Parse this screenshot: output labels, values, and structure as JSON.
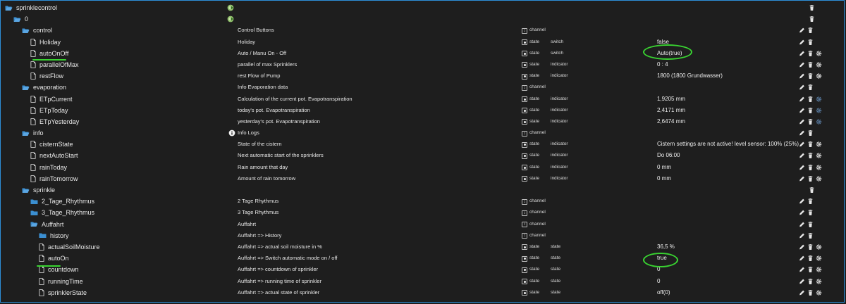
{
  "rows": [
    {
      "indent": 0,
      "kind": "folder-open",
      "name": "sprinklecontrol",
      "desc": "",
      "type": "",
      "role": "",
      "value": "",
      "special": "export",
      "actions": [
        "delete"
      ]
    },
    {
      "indent": 1,
      "kind": "folder-open",
      "name": "0",
      "desc": "",
      "type": "",
      "role": "",
      "value": "",
      "special": "export",
      "actions": [
        "delete"
      ]
    },
    {
      "indent": 2,
      "kind": "folder-open",
      "name": "control",
      "desc": "Control Buttons",
      "type": "channel",
      "role": "",
      "value": "",
      "actions": [
        "edit",
        "delete"
      ]
    },
    {
      "indent": 3,
      "kind": "file",
      "name": "Holiday",
      "desc": "Holiday",
      "type": "state",
      "role": "switch",
      "value": "false",
      "actions": [
        "edit",
        "delete"
      ]
    },
    {
      "indent": 3,
      "kind": "file",
      "name": "autoOnOff",
      "desc": "Auto / Manu On - Off",
      "type": "state",
      "role": "switch",
      "value": "Auto(true)",
      "actions": [
        "edit",
        "delete",
        "settings"
      ]
    },
    {
      "indent": 3,
      "kind": "file",
      "name": "parallelOfMax",
      "desc": "parallel of max Sprinklers",
      "type": "state",
      "role": "indicator",
      "value": "0 : 4",
      "actions": [
        "edit",
        "delete",
        "settings"
      ]
    },
    {
      "indent": 3,
      "kind": "file",
      "name": "restFlow",
      "desc": "rest Flow of Pump",
      "type": "state",
      "role": "indicator",
      "value": "1800 (1800 Grundwasser)",
      "actions": [
        "edit",
        "delete",
        "settings"
      ]
    },
    {
      "indent": 2,
      "kind": "folder-open",
      "name": "evaporation",
      "desc": "Info Evaporation data",
      "type": "channel",
      "role": "",
      "value": "",
      "actions": [
        "edit",
        "delete"
      ]
    },
    {
      "indent": 3,
      "kind": "file",
      "name": "ETpCurrent",
      "desc": "Calculation of the current pot. Evapotranspiration",
      "type": "state",
      "role": "indicator",
      "value": "1,9205 mm",
      "actions": [
        "edit",
        "delete",
        "settings-dim"
      ]
    },
    {
      "indent": 3,
      "kind": "file",
      "name": "ETpToday",
      "desc": "today's pot. Evapotranspiration",
      "type": "state",
      "role": "indicator",
      "value": "2,4171 mm",
      "actions": [
        "edit",
        "delete",
        "settings-dim"
      ]
    },
    {
      "indent": 3,
      "kind": "file",
      "name": "ETpYesterday",
      "desc": "yesterday's pot. Evapotranspiration",
      "type": "state",
      "role": "indicator",
      "value": "2,6474 mm",
      "actions": [
        "edit",
        "delete",
        "settings-dim"
      ]
    },
    {
      "indent": 2,
      "kind": "folder-open",
      "name": "info",
      "desc": "Info Logs",
      "type": "channel",
      "role": "",
      "value": "",
      "special": "info",
      "actions": [
        "edit",
        "delete"
      ]
    },
    {
      "indent": 3,
      "kind": "file",
      "name": "cisternState",
      "desc": "State of the cistern",
      "type": "state",
      "role": "indicator",
      "value": "Cistern settings are not active! level sensor: 100% (25%)",
      "actions": [
        "edit",
        "delete",
        "settings"
      ]
    },
    {
      "indent": 3,
      "kind": "file",
      "name": "nextAutoStart",
      "desc": "Next automatic start of the sprinklers",
      "type": "state",
      "role": "indicator",
      "value": "Do 06:00",
      "actions": [
        "edit",
        "delete",
        "settings"
      ]
    },
    {
      "indent": 3,
      "kind": "file",
      "name": "rainToday",
      "desc": "Rain amount that day",
      "type": "state",
      "role": "indicator",
      "value": "0 mm",
      "actions": [
        "edit",
        "delete",
        "settings"
      ]
    },
    {
      "indent": 3,
      "kind": "file",
      "name": "rainTomorrow",
      "desc": "Amount of rain tomorrow",
      "type": "state",
      "role": "indicator",
      "value": "0 mm",
      "actions": [
        "edit",
        "delete",
        "settings"
      ]
    },
    {
      "indent": 2,
      "kind": "folder-open",
      "name": "sprinkle",
      "desc": "",
      "type": "",
      "role": "",
      "value": "",
      "actions": [
        "delete"
      ]
    },
    {
      "indent": 3,
      "kind": "folder",
      "name": "2_Tage_Rhythmus",
      "desc": "2 Tage Rhythmus",
      "type": "channel",
      "role": "",
      "value": "",
      "actions": [
        "edit",
        "delete"
      ]
    },
    {
      "indent": 3,
      "kind": "folder",
      "name": "3_Tage_Rhythmus",
      "desc": "3 Tage Rhythmus",
      "type": "channel",
      "role": "",
      "value": "",
      "actions": [
        "edit",
        "delete"
      ]
    },
    {
      "indent": 3,
      "kind": "folder-open",
      "name": "Auffahrt",
      "desc": "Auffahrt",
      "type": "channel",
      "role": "",
      "value": "",
      "actions": [
        "edit",
        "delete"
      ]
    },
    {
      "indent": 4,
      "kind": "folder",
      "name": "history",
      "desc": "Auffahrt => History",
      "type": "channel",
      "role": "",
      "value": "",
      "actions": [
        "edit",
        "delete"
      ]
    },
    {
      "indent": 4,
      "kind": "file",
      "name": "actualSoilMoisture",
      "desc": "Auffahrt => actual soil moisture in %",
      "type": "state",
      "role": "state",
      "value": "36,5 %",
      "actions": [
        "edit",
        "delete",
        "settings"
      ]
    },
    {
      "indent": 4,
      "kind": "file",
      "name": "autoOn",
      "desc": "Auffahrt => Switch automatic mode on / off",
      "type": "state",
      "role": "state",
      "value": "true",
      "actions": [
        "edit",
        "delete",
        "settings"
      ]
    },
    {
      "indent": 4,
      "kind": "file",
      "name": "countdown",
      "desc": "Auffahrt => countdown of sprinkler",
      "type": "state",
      "role": "state",
      "value": "0",
      "actions": [
        "edit",
        "delete",
        "settings"
      ]
    },
    {
      "indent": 4,
      "kind": "file",
      "name": "runningTime",
      "desc": "Auffahrt => running time of sprinkler",
      "type": "state",
      "role": "state",
      "value": "0",
      "actions": [
        "edit",
        "delete",
        "settings"
      ]
    },
    {
      "indent": 4,
      "kind": "file",
      "name": "sprinklerState",
      "desc": "Auffahrt => actual state of sprinkler",
      "type": "state",
      "role": "state",
      "value": "off(0)",
      "actions": [
        "edit",
        "delete",
        "settings"
      ]
    }
  ],
  "colors": {
    "folder": "#3b8fd1",
    "background": "#1e1e1e",
    "highlight": "#39d331",
    "icon": "#e0e0e0"
  }
}
